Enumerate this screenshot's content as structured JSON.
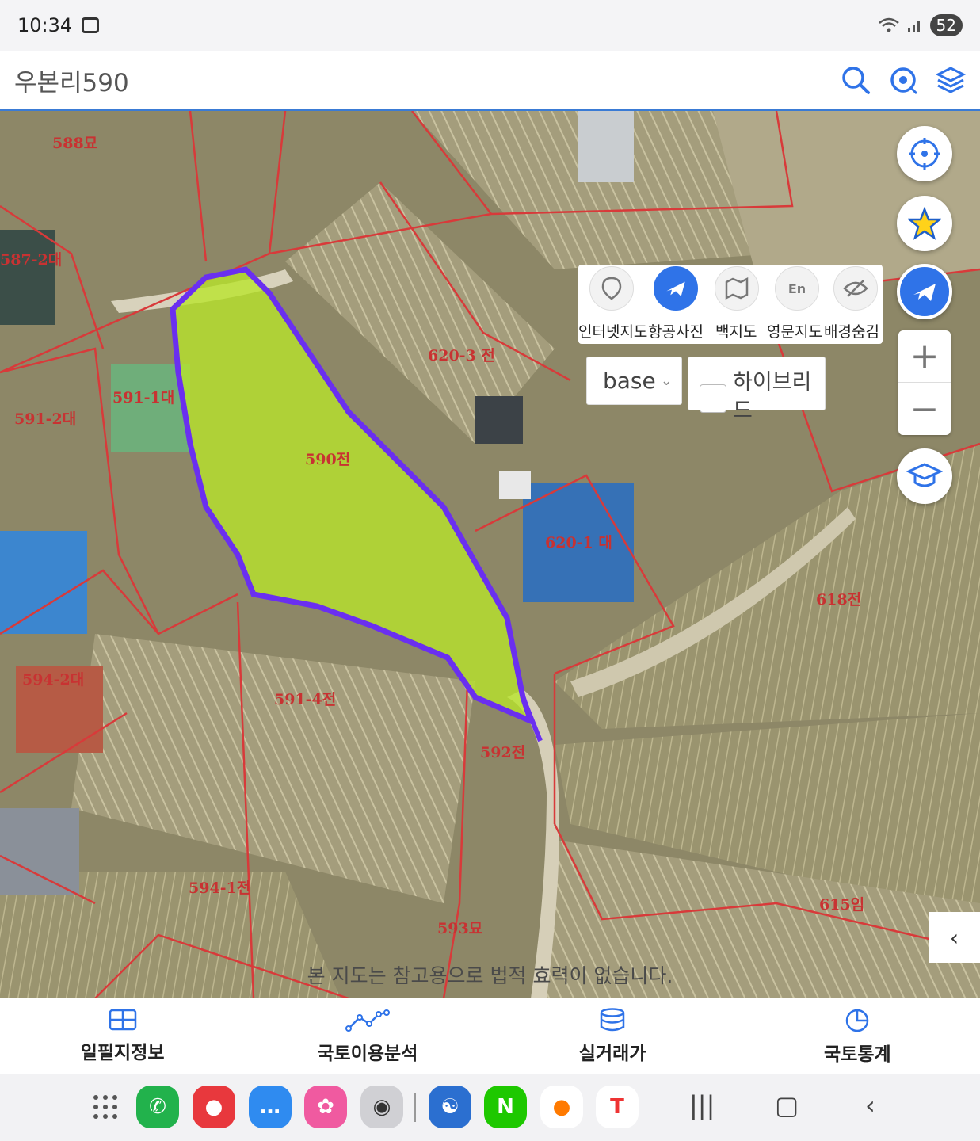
{
  "status": {
    "time": "10:34",
    "battery": "52"
  },
  "header": {
    "title": "우본리590"
  },
  "map": {
    "parcels": [
      {
        "label": "588묘"
      },
      {
        "label": "587-2대"
      },
      {
        "label": "591-1대"
      },
      {
        "label": "591-2대"
      },
      {
        "label": "590전"
      },
      {
        "label": "620-3 전"
      },
      {
        "label": "620-1 대"
      },
      {
        "label": "618전"
      },
      {
        "label": "591-4전"
      },
      {
        "label": "592전"
      },
      {
        "label": "594-2대"
      },
      {
        "label": "594-1전"
      },
      {
        "label": "593묘"
      },
      {
        "label": "615임"
      }
    ],
    "disclaimer": "본 지도는 참고용으로 법적 효력이 없습니다."
  },
  "maptypes": [
    {
      "label": "인터넷지도",
      "icon": "map-pin-icon",
      "active": false
    },
    {
      "label": "항공사진",
      "icon": "airplane-icon",
      "active": true
    },
    {
      "label": "백지도",
      "icon": "blank-map-icon",
      "active": false
    },
    {
      "label": "영문지도",
      "icon": "english-map-icon",
      "active": false
    },
    {
      "label": "배경숨김",
      "icon": "eye-off-icon",
      "active": false
    }
  ],
  "base_select": {
    "value": "base"
  },
  "hybrid": {
    "label": "하이브리드"
  },
  "bottom_nav": [
    {
      "label": "일필지정보",
      "icon": "parcel-grid-icon"
    },
    {
      "label": "국토이용분석",
      "icon": "analysis-line-icon"
    },
    {
      "label": "실거래가",
      "icon": "database-icon"
    },
    {
      "label": "국토통계",
      "icon": "pie-chart-icon"
    }
  ],
  "colors": {
    "accent": "#2f73e8",
    "parcel_line": "#d83a3a",
    "selection": "#6a2ff0",
    "highlight_fill": "#b8e62a"
  }
}
